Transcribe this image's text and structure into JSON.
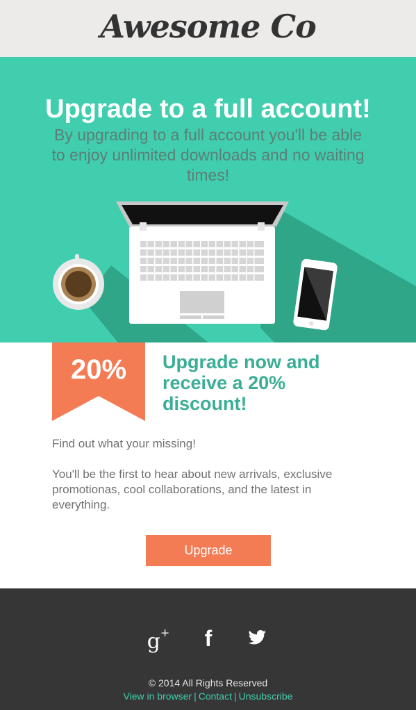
{
  "header": {
    "logo": "Awesome Co"
  },
  "hero": {
    "title": "Upgrade to a full account!",
    "subtitle": "By upgrading to a full account you'll be able to enjoy unlimited downloads and no waiting times!"
  },
  "offer": {
    "badge": "20%",
    "title": "Upgrade now and receive a 20% discount!",
    "paragraph1": "Find out what your missing!",
    "paragraph2": "You'll be the first to hear about new arrivals, exclusive promotionas, cool collaborations, and the latest in everything.",
    "button_label": "Upgrade"
  },
  "footer": {
    "social": [
      "google-plus-icon",
      "facebook-icon",
      "twitter-icon"
    ],
    "gplus_glyph": "g",
    "gplus_sup": "+",
    "fb_glyph": "f",
    "copyright": "© 2014 All Rights Reserved",
    "links": [
      "View in browser",
      "Contact",
      "Unsubscribe"
    ],
    "separator": "|"
  },
  "colors": {
    "accent": "#41ceaf",
    "button": "#f37c55",
    "footer_bg": "#363636",
    "header_bg": "#ecebe9"
  }
}
